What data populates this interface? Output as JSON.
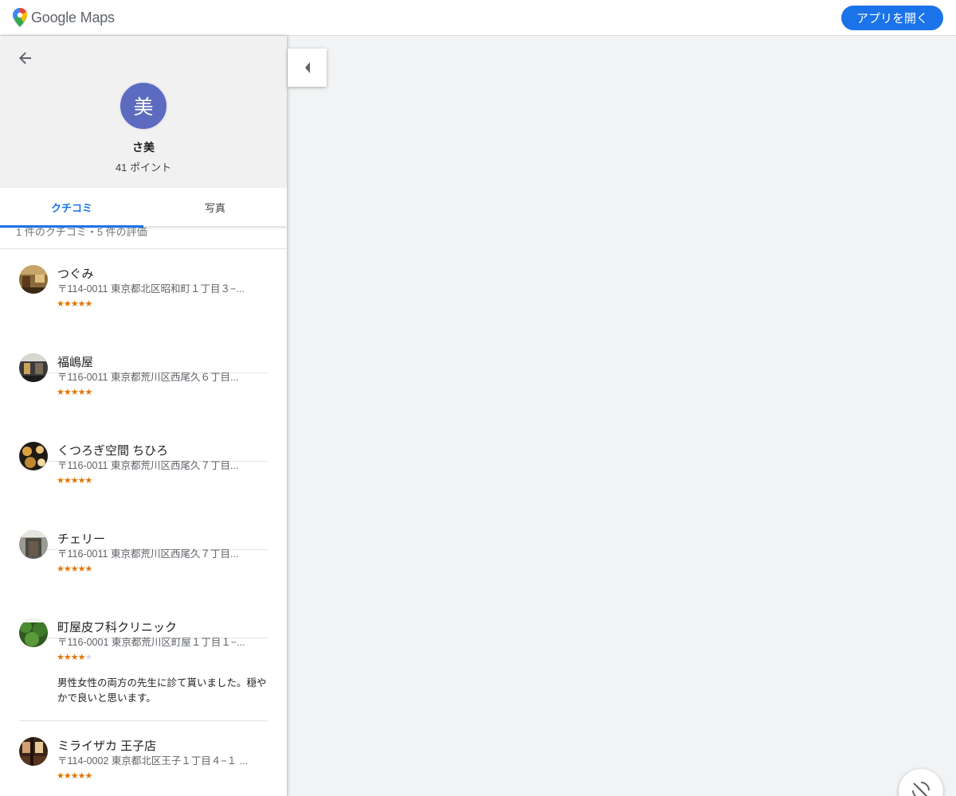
{
  "header": {
    "logo_text": "Google Maps",
    "open_app_label": "アプリを開く"
  },
  "profile": {
    "avatar_letter": "美",
    "name": "さ美",
    "points": "41 ポイント"
  },
  "tabs": [
    {
      "label": "クチコミ",
      "active": true
    },
    {
      "label": "写真",
      "active": false
    }
  ],
  "summary": "1 件のクチコミ・5 件の評価",
  "reviews": [
    {
      "place": "つぐみ",
      "address": "〒114-0011 東京都北区昭和町１丁目３−...",
      "rating": 5,
      "text": ""
    },
    {
      "place": "福嶋屋",
      "address": "〒116-0011 東京都荒川区西尾久６丁目...",
      "rating": 5,
      "text": ""
    },
    {
      "place": "くつろぎ空間 ちひろ",
      "address": "〒116-0011 東京都荒川区西尾久７丁目...",
      "rating": 5,
      "text": ""
    },
    {
      "place": "チェリー",
      "address": "〒116-0011 東京都荒川区西尾久７丁目...",
      "rating": 5,
      "text": ""
    },
    {
      "place": "町屋皮フ科クリニック",
      "address": "〒116-0001 東京都荒川区町屋１丁目１−...",
      "rating": 4,
      "text": "男性女性の両方の先生に診て貰いました。穏やかで良いと思います。"
    },
    {
      "place": "ミライザカ 王子店",
      "address": "〒114-0002 東京都北区王子１丁目４−１ ...",
      "rating": 5,
      "text": ""
    }
  ],
  "colors": {
    "accent": "#1a73e8",
    "avatar": "#5c6bc0",
    "star": "#e37400"
  },
  "icons": {
    "back": "arrow-left-icon",
    "collapse": "caret-left-icon",
    "corner": "rotate-off-icon"
  }
}
